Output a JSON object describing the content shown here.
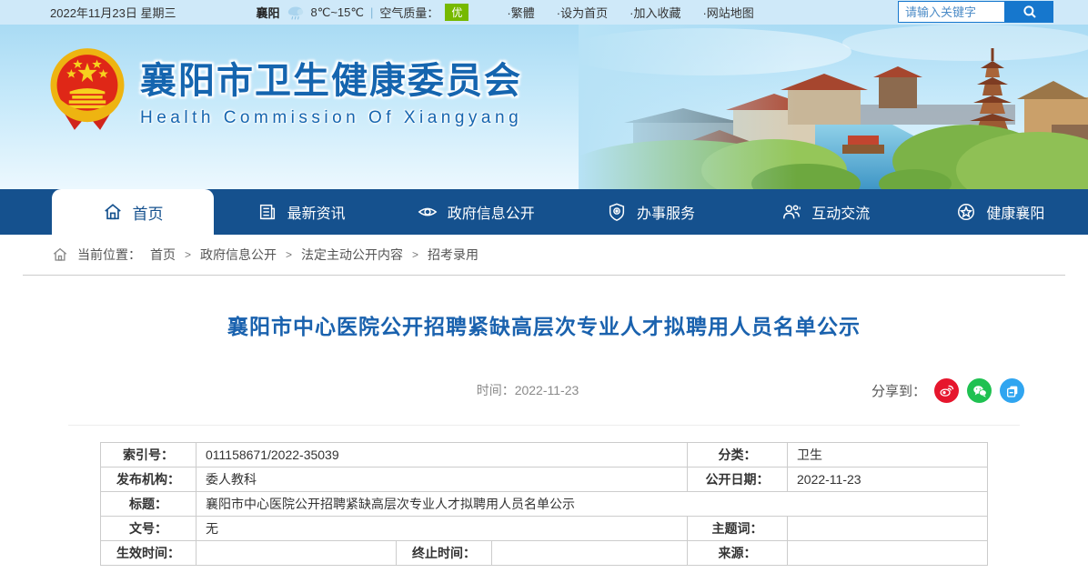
{
  "topbar": {
    "date": "2022年11月23日 星期三",
    "city": "襄阳",
    "temperature": "8℃~15℃",
    "pipe": "|",
    "air_quality_label": "空气质量：",
    "air_quality_value": "优",
    "links": [
      "·繁體",
      "·设为首页",
      "·加入收藏",
      "·网站地图"
    ],
    "search": {
      "placeholder": "请输入关键字"
    }
  },
  "header": {
    "title": "襄阳市卫生健康委员会",
    "subtitle": "Health Commission Of Xiangyang"
  },
  "nav": {
    "items": [
      {
        "label": "首页",
        "active": true
      },
      {
        "label": "最新资讯",
        "active": false
      },
      {
        "label": "政府信息公开",
        "active": false
      },
      {
        "label": "办事服务",
        "active": false
      },
      {
        "label": "互动交流",
        "active": false
      },
      {
        "label": "健康襄阳",
        "active": false
      }
    ]
  },
  "breadcrumb": {
    "label": "当前位置：",
    "separator": ">",
    "items": [
      "首页",
      "政府信息公开",
      "法定主动公开内容",
      "招考录用"
    ]
  },
  "article": {
    "title": "襄阳市中心医院公开招聘紧缺高层次专业人才拟聘用人员名单公示",
    "time_label": "时间：",
    "time_value": "2022-11-23",
    "share_label": "分享到：",
    "share_icons": [
      "weibo-icon",
      "wechat-icon",
      "copy-icon"
    ]
  },
  "meta_table": {
    "index_label": "索引号：",
    "index_value": "011158671/2022-35039",
    "category_label": "分类：",
    "category_value": "卫生",
    "agency_label": "发布机构：",
    "agency_value": "委人教科",
    "pub_date_label": "公开日期：",
    "pub_date_value": "2022-11-23",
    "title_label": "标题：",
    "title_value": "襄阳市中心医院公开招聘紧缺高层次专业人才拟聘用人员名单公示",
    "doc_no_label": "文号：",
    "doc_no_value": "无",
    "keywords_label": "主题词：",
    "keywords_value": "",
    "effective_label": "生效时间：",
    "effective_value": "",
    "expiry_label": "终止时间：",
    "expiry_value": "",
    "source_label": "来源：",
    "source_value": ""
  },
  "colors": {
    "nav_blue": "#15518e",
    "brand_blue": "#1565af",
    "title_blue": "#1a62ae",
    "topbar_bg": "#cfe9f9",
    "aq_green": "#76b900",
    "search_blue": "#1677cd",
    "weibo_red": "#e6162d",
    "wechat_green": "#1fc151",
    "copy_blue": "#30a5f0"
  }
}
